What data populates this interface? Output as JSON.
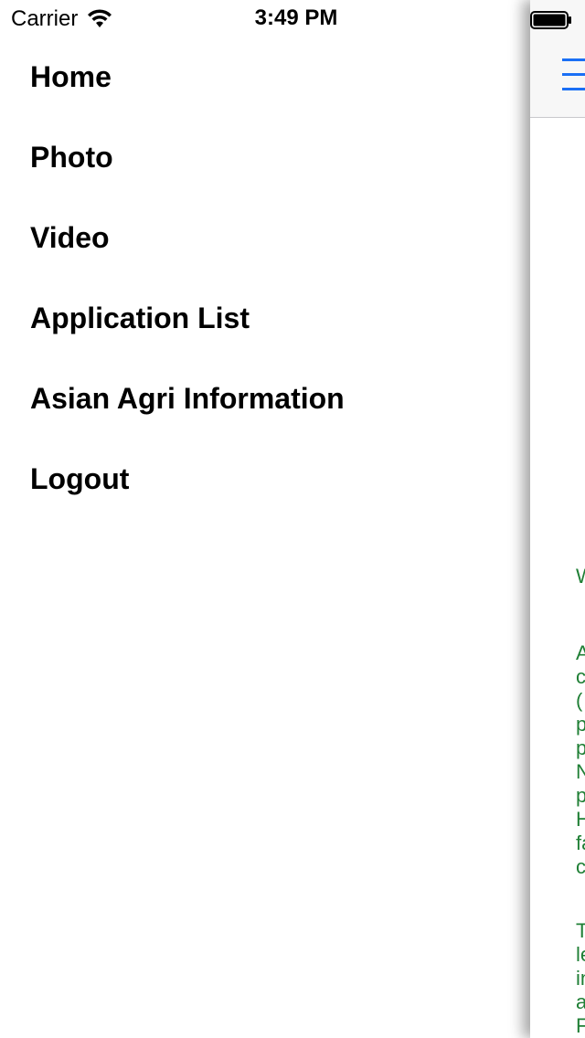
{
  "status_bar": {
    "carrier": "Carrier",
    "time": "3:49 PM"
  },
  "menu": {
    "items": [
      {
        "label": "Home"
      },
      {
        "label": "Photo"
      },
      {
        "label": "Video"
      },
      {
        "label": "Application List"
      },
      {
        "label": "Asian Agri Information"
      },
      {
        "label": "Logout"
      }
    ]
  },
  "main": {
    "text_block_1": "W",
    "text_block_2": "A\nc\n(\np\np\nN\np\nH\nfa\nc",
    "text_block_3": "T\nle\nin\na\nF"
  },
  "colors": {
    "accent": "#1a6ff5",
    "content_text": "#1f7f35"
  }
}
